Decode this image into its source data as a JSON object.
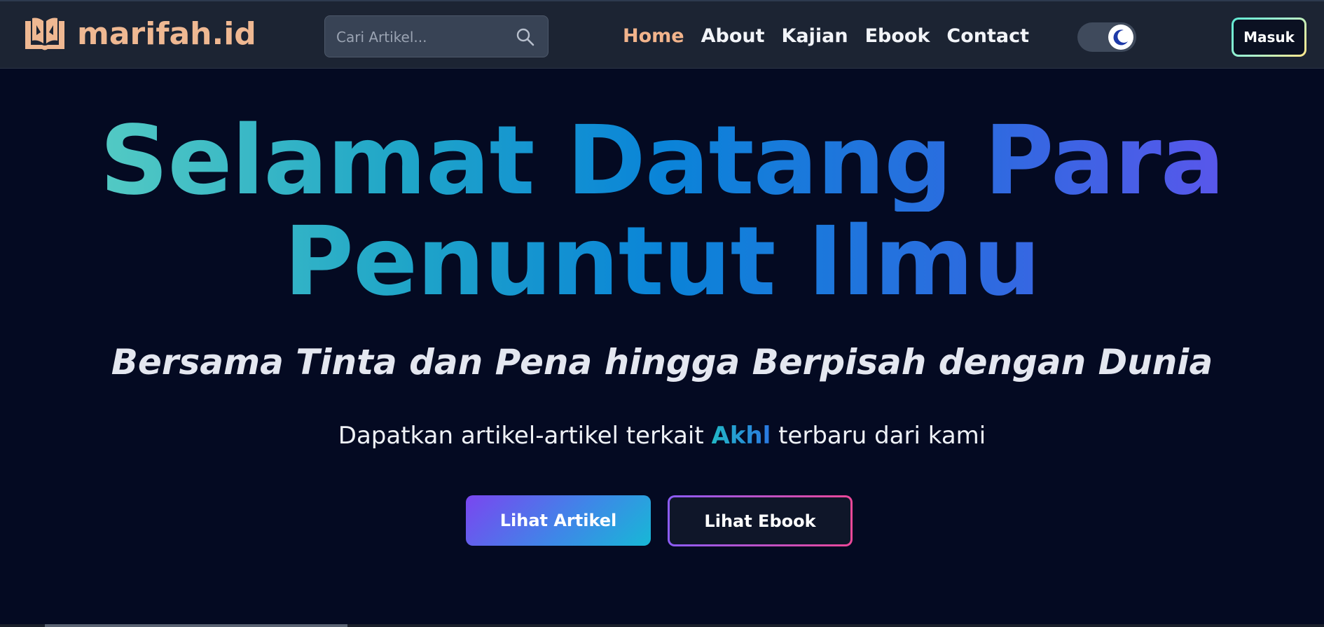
{
  "header": {
    "logo_text": "marifah.id",
    "logo_icon": "open-book-icon",
    "search": {
      "placeholder": "Cari Artikel...",
      "value": "",
      "icon": "search-icon"
    },
    "nav": [
      {
        "label": "Home",
        "active": true
      },
      {
        "label": "About",
        "active": false
      },
      {
        "label": "Kajian",
        "active": false
      },
      {
        "label": "Ebook",
        "active": false
      },
      {
        "label": "Contact",
        "active": false
      }
    ],
    "theme_toggle": {
      "icon": "moon-icon",
      "state": "dark"
    },
    "login_label": "Masuk"
  },
  "hero": {
    "title_line1": "Selamat Datang Para",
    "title_line2": "Penuntut Ilmu",
    "tagline": "Bersama Tinta dan Pena hingga Berpisah dengan Dunia",
    "sub_before": "Dapatkan artikel-artikel terkait ",
    "sub_highlight": "Akhl",
    "sub_after": " terbaru dari kami",
    "primary_button": "Lihat Artikel",
    "secondary_button": "Lihat Ebook"
  },
  "colors": {
    "background": "#040a22",
    "navbar": "#1c2433",
    "brand": "#efb892",
    "active_nav": "#f2b48c",
    "gradient_start": "#64d6c2",
    "gradient_end": "#6b4ef0"
  }
}
